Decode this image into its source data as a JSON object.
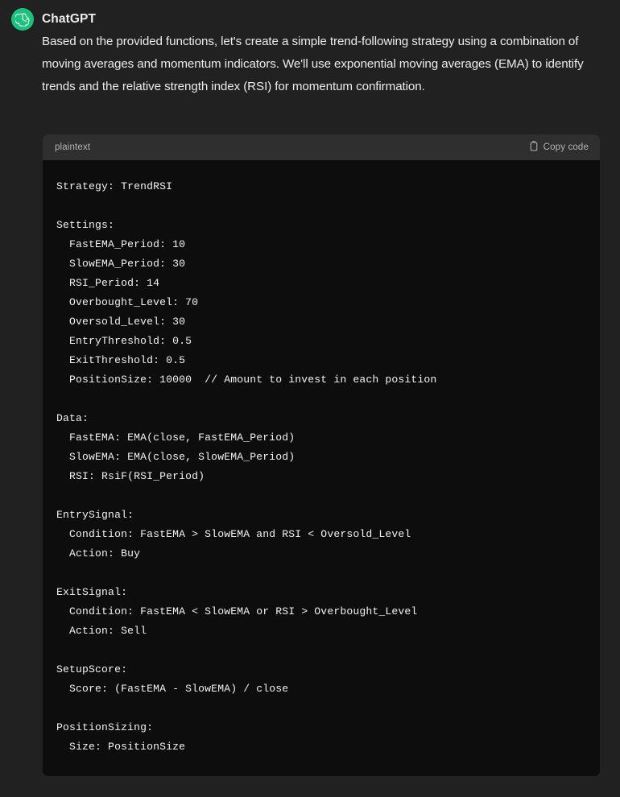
{
  "message": {
    "author": "ChatGPT",
    "avatar_icon": "openai-logo-icon",
    "avatar_color": "#19c37d",
    "paragraph": "Based on the provided functions, let's create a simple trend-following strategy using a combination of moving averages and momentum indicators. We'll use exponential moving averages (EMA) to identify trends and the relative strength index (RSI) for momentum confirmation."
  },
  "code_block": {
    "language": "plaintext",
    "copy_label": "Copy code",
    "copy_icon": "clipboard-icon",
    "code": "Strategy: TrendRSI\n\nSettings:\n  FastEMA_Period: 10\n  SlowEMA_Period: 30\n  RSI_Period: 14\n  Overbought_Level: 70\n  Oversold_Level: 30\n  EntryThreshold: 0.5\n  ExitThreshold: 0.5\n  PositionSize: 10000  // Amount to invest in each position\n\nData:\n  FastEMA: EMA(close, FastEMA_Period)\n  SlowEMA: EMA(close, SlowEMA_Period)\n  RSI: RsiF(RSI_Period)\n\nEntrySignal:\n  Condition: FastEMA > SlowEMA and RSI < Oversold_Level\n  Action: Buy\n\nExitSignal:\n  Condition: FastEMA < SlowEMA or RSI > Overbought_Level\n  Action: Sell\n\nSetupScore:\n  Score: (FastEMA - SlowEMA) / close\n\nPositionSizing:\n  Size: PositionSize"
  },
  "colors": {
    "page_background": "#212121",
    "code_header_background": "#2f2f2f",
    "code_body_background": "#0d0d0d",
    "accent_green": "#19c37d",
    "primary_text": "#ececec",
    "muted_text": "#b4b4b4"
  }
}
